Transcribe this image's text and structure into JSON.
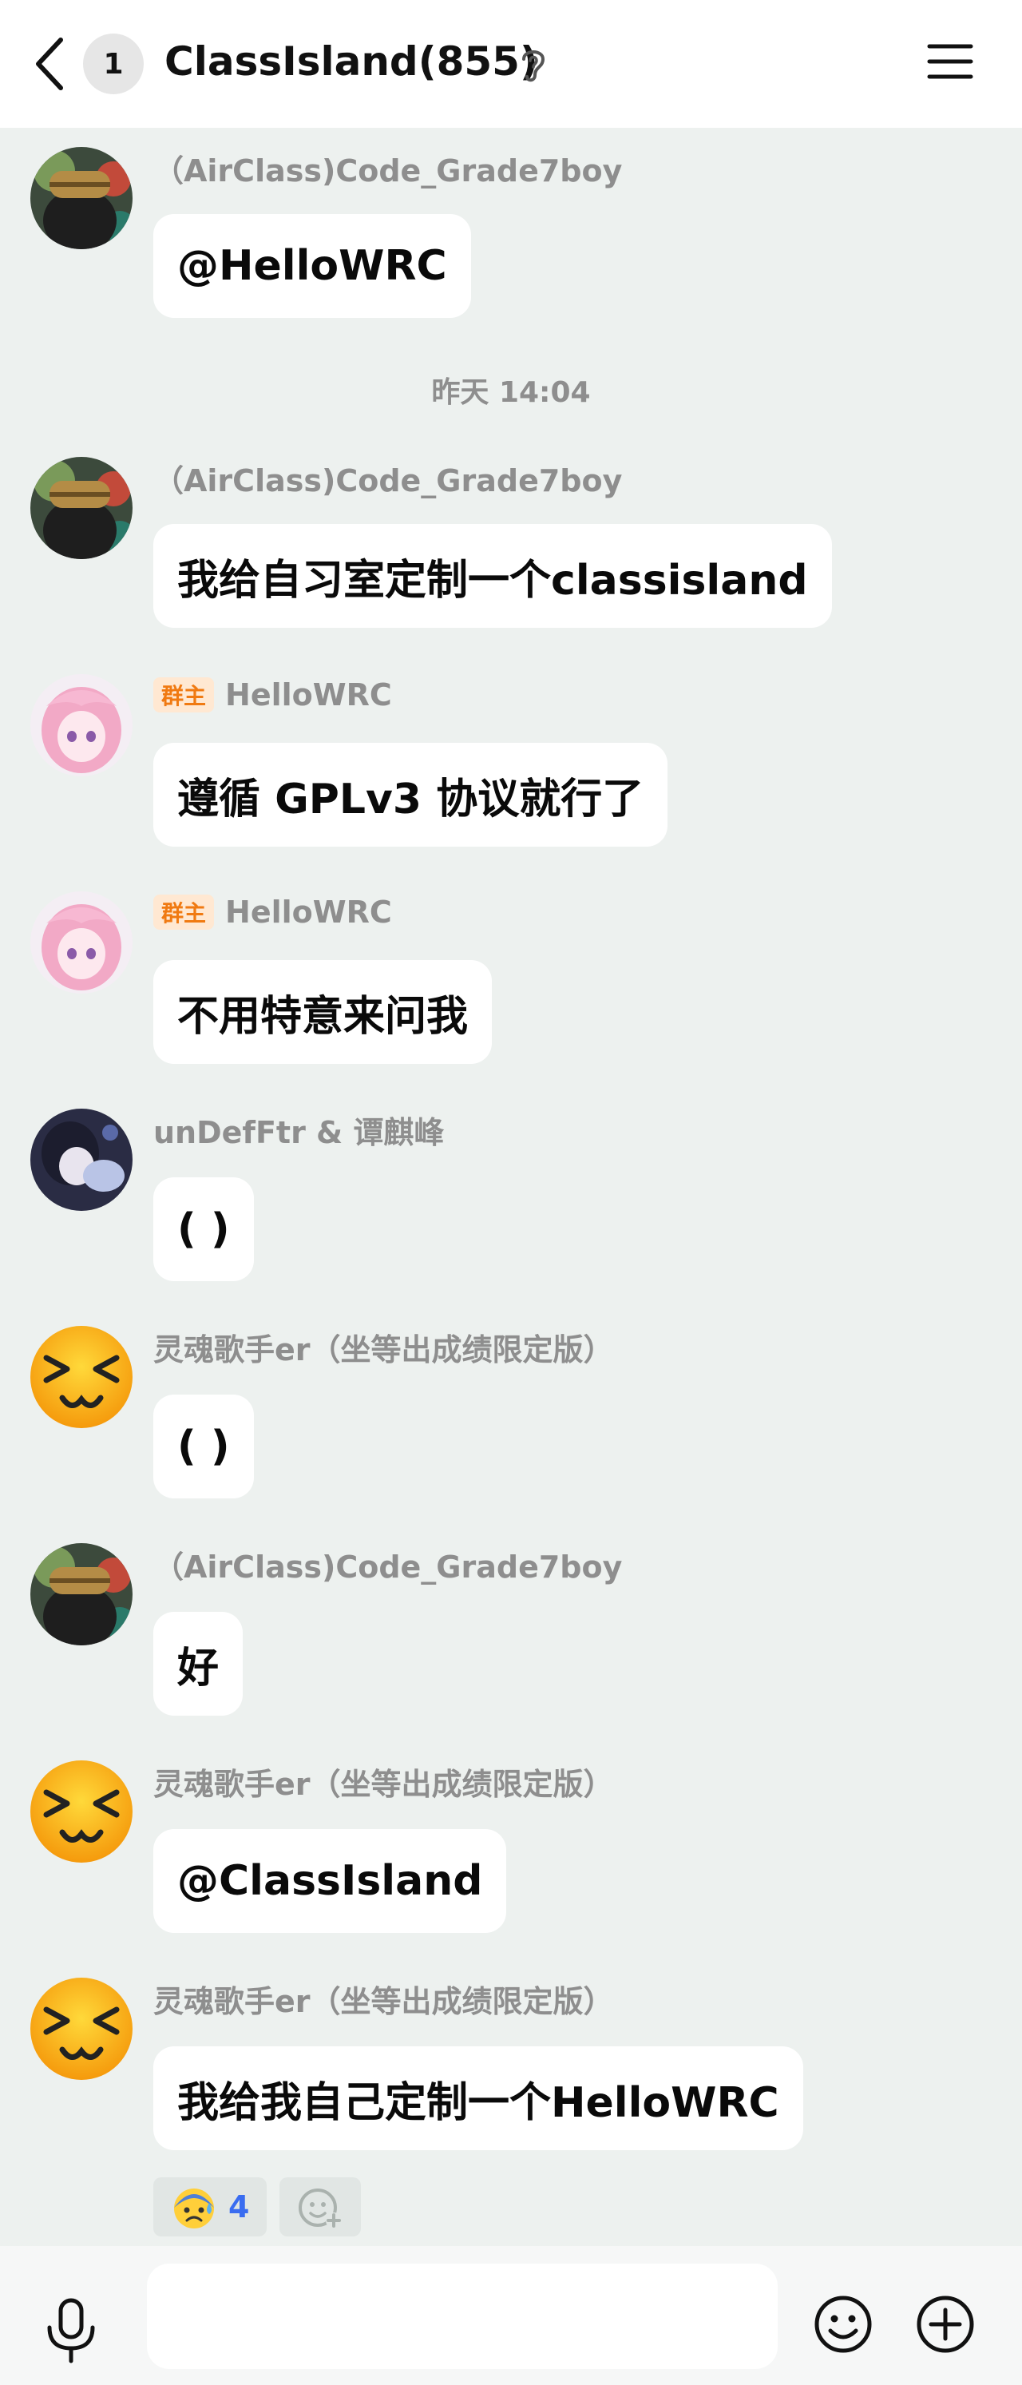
{
  "header": {
    "unread_count": "1",
    "title": "ClassIsland(855)",
    "back_icon": "chevron-left-icon",
    "ear_icon": "ear-icon",
    "menu_icon": "menu-icon"
  },
  "timestamp": "昨天 14:04",
  "messages": [
    {
      "sender": "（AirClass)Code_Grade7boy",
      "text": "@HelloWRC",
      "avatar": "avatar-airclass"
    },
    {
      "sender": "（AirClass)Code_Grade7boy",
      "text": "我给自习室定制一个classisland",
      "avatar": "avatar-airclass"
    },
    {
      "badge": "群主",
      "sender": "HelloWRC",
      "text": "遵循 GPLv3 协议就行了",
      "avatar": "avatar-hellowrc"
    },
    {
      "badge": "群主",
      "sender": "HelloWRC",
      "text": "不用特意来问我",
      "avatar": "avatar-hellowrc"
    },
    {
      "sender": "unDefFtr & 谭麒峰",
      "text": "( )",
      "avatar": "avatar-undefftr"
    },
    {
      "sender": "灵魂歌手er（坐等出成绩限定版）",
      "text": "( )",
      "avatar": "avatar-lhgs"
    },
    {
      "sender": "（AirClass)Code_Grade7boy",
      "text": "好",
      "avatar": "avatar-airclass"
    },
    {
      "sender": "灵魂歌手er（坐等出成绩限定版）",
      "text": "@ClassIsland",
      "avatar": "avatar-lhgs"
    },
    {
      "sender": "灵魂歌手er（坐等出成绩限定版）",
      "text": "我给我自己定制一个HelloWRC",
      "avatar": "avatar-lhgs"
    }
  ],
  "reactions": [
    {
      "emoji": "anxious-sweat-emoji",
      "count": "4"
    },
    {
      "emoji": "add-reaction-icon"
    }
  ],
  "input_bar": {
    "placeholder": "",
    "voice_icon": "microphone-icon",
    "emoji_icon": "smiley-icon",
    "plus_icon": "plus-circle-icon"
  },
  "colors": {
    "background": "#edf1ef",
    "bubble": "#ffffff",
    "owner_badge_text": "#f07a12",
    "owner_badge_bg": "#ffe8d2",
    "reaction_count": "#3a6df0",
    "sender_name": "#8e8e8e"
  }
}
